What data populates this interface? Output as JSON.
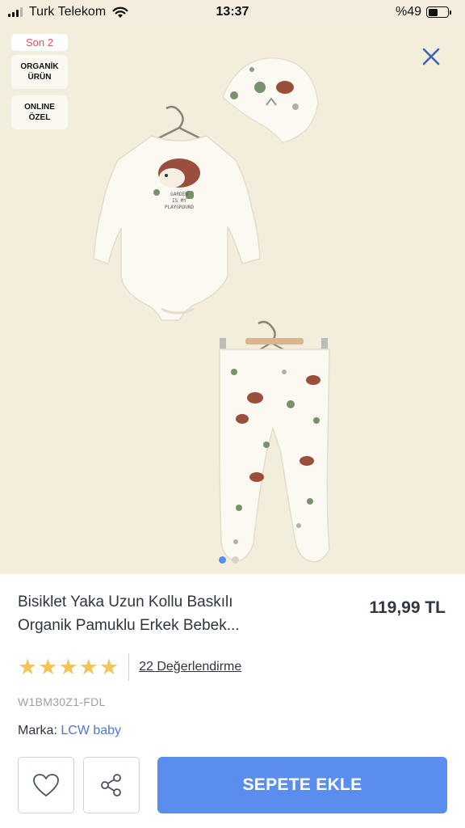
{
  "status_bar": {
    "carrier": "Turk Telekom",
    "time": "13:37",
    "battery": "%49",
    "battery_level": 0.49
  },
  "gallery": {
    "badge_stock": "Son 2",
    "badge_organic_line1": "ORGANİK",
    "badge_organic_line2": "ÜRÜN",
    "badge_online_line1": "ONLINE",
    "badge_online_line2": "ÖZEL",
    "bodysuit_print_line1": "GARDEN",
    "bodysuit_print_line2": "IS MY",
    "bodysuit_print_line3": "PLAYGROUND",
    "close_icon": "close-icon",
    "slide_count": 2,
    "active_slide": 1
  },
  "product": {
    "title_line1": "Bisiklet Yaka Uzun Kollu Baskılı",
    "title_line2": "Organik Pamuklu Erkek Bebek...",
    "price": "119,99 TL",
    "rating": 5,
    "stars": [
      "★",
      "★",
      "★",
      "★",
      "★"
    ],
    "reviews": "22 Değerlendirme",
    "sku": "W1BM30Z1-FDL",
    "brand_label": "Marka:",
    "brand_name": "LCW baby"
  },
  "actions": {
    "favorite_icon": "heart-icon",
    "share_icon": "share-icon",
    "add_to_cart": "SEPETE EKLE"
  },
  "colors": {
    "accent": "#5b8def",
    "star": "#f2c45a",
    "stock_badge": "#e0545c",
    "background": "#f3eddc"
  }
}
